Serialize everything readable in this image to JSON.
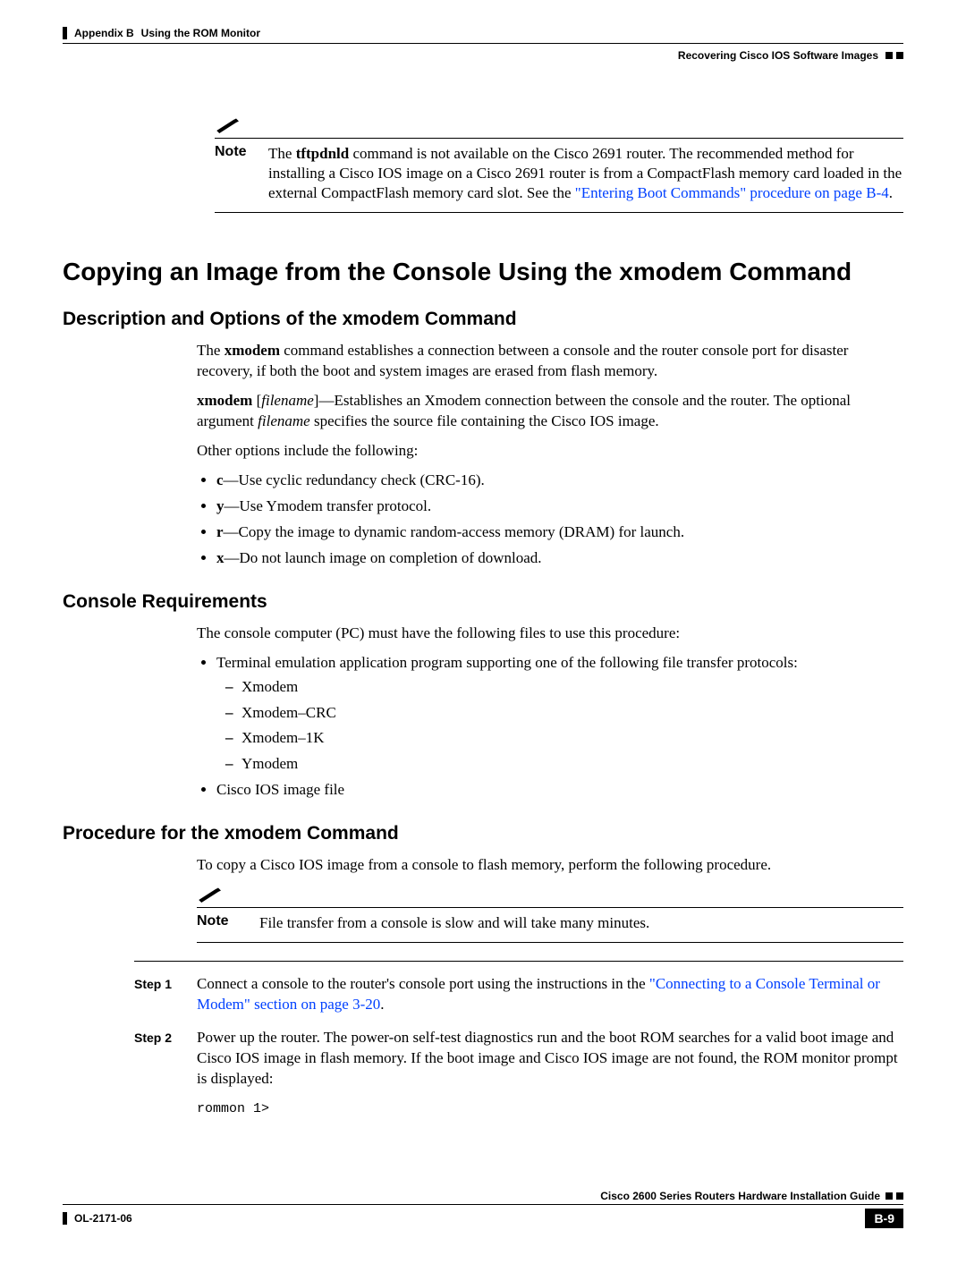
{
  "header": {
    "appendix": "Appendix B",
    "topic": "Using the ROM Monitor",
    "section": "Recovering Cisco IOS Software Images"
  },
  "note1": {
    "label": "Note",
    "text_prefix": "The ",
    "cmd": "tftpdnld",
    "text_mid": " command is not available on the Cisco 2691 router. The recommended method for installing a Cisco IOS image on a Cisco 2691 router is from a CompactFlash memory card loaded in the external CompactFlash memory card slot. See the ",
    "link": "\"Entering Boot Commands\" procedure on page B-4",
    "text_end": "."
  },
  "title1": "Copying an Image from the Console Using the xmodem Command",
  "sub1": "Description and Options of the xmodem Command",
  "desc_p1_prefix": "The ",
  "desc_p1_cmd": "xmodem",
  "desc_p1_rest": " command establishes a connection between a console and the router console port for disaster recovery, if both the boot and system images are erased from flash memory.",
  "desc_p2_cmd": "xmodem",
  "desc_p2_arg": "filename",
  "desc_p2_mid": "—Establishes an Xmodem connection between the console and the router. The optional argument ",
  "desc_p2_arg2": "filename",
  "desc_p2_end": " specifies the source file containing the Cisco IOS image.",
  "desc_opts_intro": "Other options include the following:",
  "opts": {
    "c": "—Use cyclic redundancy check (CRC-16).",
    "y": "—Use Ymodem transfer protocol.",
    "r": "—Copy the image to dynamic random-access memory (DRAM) for launch.",
    "x": "—Do not launch image on completion of download."
  },
  "sub2": "Console Requirements",
  "cons_intro": "The console computer (PC) must have the following files to use this procedure:",
  "cons_b1": "Terminal emulation application program supporting one of the following file transfer protocols:",
  "cons_protocols": [
    "Xmodem",
    "Xmodem–CRC",
    "Xmodem–1K",
    "Ymodem"
  ],
  "cons_b2": "Cisco IOS image file",
  "sub3": "Procedure for the xmodem Command",
  "proc_intro": "To copy a Cisco IOS image from a console to flash memory, perform the following procedure.",
  "note2": {
    "label": "Note",
    "text": "File transfer from a console is slow and will take many minutes."
  },
  "steps": {
    "s1_label": "Step 1",
    "s1_text_a": "Connect a console to the router's console port using the instructions in the ",
    "s1_link": "\"Connecting to a Console Terminal or Modem\" section on page 3-20",
    "s1_text_b": ".",
    "s2_label": "Step 2",
    "s2_text": "Power up the router. The power-on self-test diagnostics run and the boot ROM searches for a valid boot image and Cisco IOS image in flash memory. If the boot image and Cisco IOS image are not found, the ROM monitor prompt is displayed:",
    "s2_code": "rommon 1>"
  },
  "footer": {
    "guide": "Cisco 2600 Series Routers Hardware Installation Guide",
    "doc": "OL-2171-06",
    "page": "B-9"
  }
}
